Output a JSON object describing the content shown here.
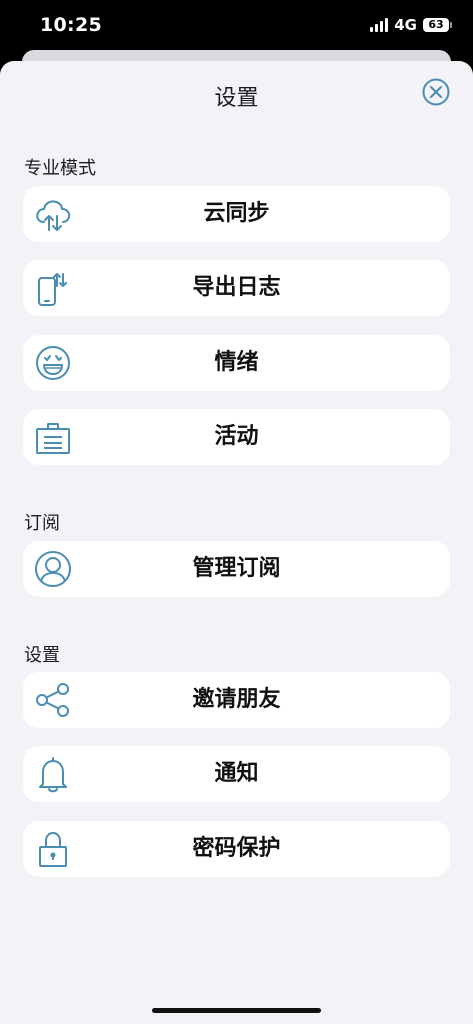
{
  "status_bar": {
    "time": "10:25",
    "network": "4G",
    "battery": "63"
  },
  "sheet": {
    "title": "设置"
  },
  "colors": {
    "accent": "#4a8db0",
    "background": "#f2f2f7"
  },
  "sections": {
    "pro": {
      "header": "专业模式",
      "items": [
        {
          "label": "云同步",
          "icon": "cloud-sync-icon"
        },
        {
          "label": "导出日志",
          "icon": "phone-export-icon"
        },
        {
          "label": "情绪",
          "icon": "emoji-face-icon"
        },
        {
          "label": "活动",
          "icon": "briefcase-icon"
        }
      ]
    },
    "subscription": {
      "header": "订阅",
      "items": [
        {
          "label": "管理订阅",
          "icon": "user-circle-icon"
        }
      ]
    },
    "settings": {
      "header": "设置",
      "items": [
        {
          "label": "邀请朋友",
          "icon": "share-icon"
        },
        {
          "label": "通知",
          "icon": "bell-icon"
        },
        {
          "label": "密码保护",
          "icon": "lock-icon"
        }
      ]
    }
  }
}
